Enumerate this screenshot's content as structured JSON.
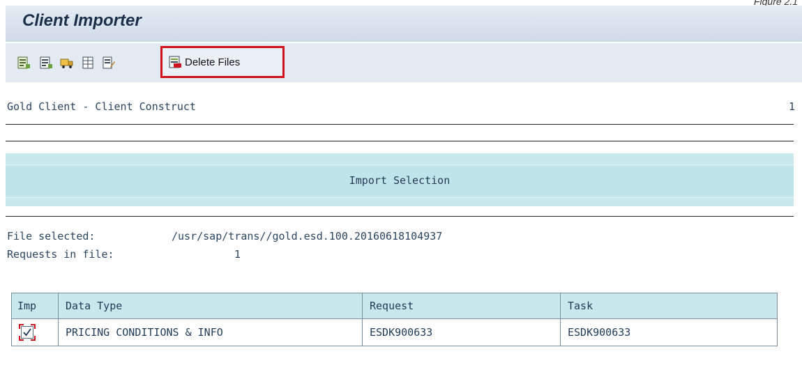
{
  "figure_caption": "Figure 2.1",
  "window": {
    "title": "Client Importer"
  },
  "toolbar": {
    "icons": [
      "execute-icon",
      "execute-list-icon",
      "transport-icon",
      "details-icon",
      "edit-document-icon"
    ],
    "delete_label": "Delete Files"
  },
  "report": {
    "heading": "Gold Client - Client Construct",
    "page_number": "1",
    "section_title": "Import Selection"
  },
  "file_info": {
    "file_label": "File selected:",
    "file_value": "/usr/sap/trans//gold.esd.100.20160618104937",
    "requests_label": "Requests in file:",
    "requests_value": "1"
  },
  "table": {
    "headers": {
      "imp": "Imp",
      "data_type": "Data Type",
      "request": "Request",
      "task": "Task"
    },
    "rows": [
      {
        "imp_checked": true,
        "data_type": "PRICING CONDITIONS & INFO",
        "request": "ESDK900633",
        "task": "ESDK900633"
      }
    ]
  },
  "colors": {
    "highlight_border": "#d0101b",
    "band_background": "#c8e8ec",
    "toolbar_background": "#e3eaf2"
  }
}
